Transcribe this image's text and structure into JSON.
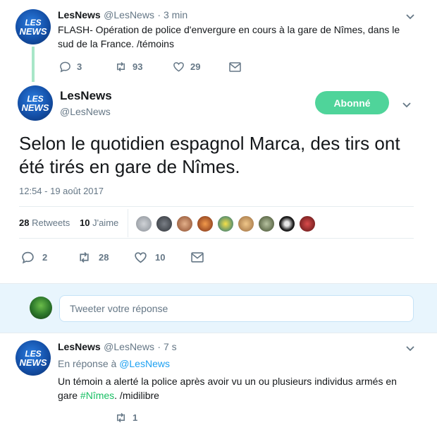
{
  "tweet1": {
    "name": "LesNews",
    "handle": "@LesNews",
    "time": "· 3 min",
    "text": "FLASH- Opération de police d'envergure en cours à la gare de Nîmes, dans le sud de la France. /témoins",
    "replies": "3",
    "retweets": "93",
    "likes": "29"
  },
  "main": {
    "name": "LesNews",
    "handle": "@LesNews",
    "follow_label": "Abonné",
    "text": "Selon le quotidien espagnol Marca, des tirs ont été tirés en gare de Nîmes.",
    "timestamp": "12:54 - 19 août 2017",
    "retweets_count": "28",
    "retweets_label": "Retweets",
    "likes_count": "10",
    "likes_label": "J'aime",
    "replies": "2",
    "retweets": "28",
    "likes": "10"
  },
  "reply_box": {
    "placeholder": "Tweeter votre réponse"
  },
  "tweet3": {
    "name": "LesNews",
    "handle": "@LesNews",
    "time": "· 7 s",
    "reply_prefix": "En réponse à",
    "reply_to": "@LesNews",
    "text_part1": "Un témoin a alerté la police après avoir vu un ou plusieurs individus armés en gare",
    "hashtag": "#Nîmes",
    "text_part2": ". /midilibre",
    "retweets": "1"
  },
  "avatar_logo": "LES NEWS",
  "colors": {
    "follow_green": "#4fd49a",
    "link_blue": "#1da1f2",
    "hashtag_green": "#17bf63",
    "muted": "#657786"
  }
}
